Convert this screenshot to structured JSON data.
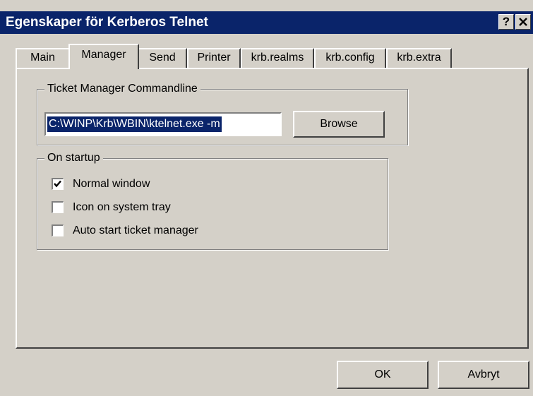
{
  "window": {
    "title": "Egenskaper för Kerberos Telnet",
    "help_label": "?",
    "close_label": "✕"
  },
  "tabs": [
    {
      "label": "Main",
      "active": false
    },
    {
      "label": "Manager",
      "active": true
    },
    {
      "label": "Send",
      "active": false
    },
    {
      "label": "Printer",
      "active": false
    },
    {
      "label": "krb.realms",
      "active": false
    },
    {
      "label": "krb.config",
      "active": false
    },
    {
      "label": "krb.extra",
      "active": false
    }
  ],
  "ticket_manager": {
    "group_label": "Ticket Manager Commandline",
    "command_value": "C:\\WINP\\Krb\\WBIN\\ktelnet.exe -m",
    "browse_label": "Browse"
  },
  "startup": {
    "group_label": "On startup",
    "options": [
      {
        "label": "Normal window",
        "checked": true
      },
      {
        "label": "Icon on system tray",
        "checked": false
      },
      {
        "label": "Auto start ticket manager",
        "checked": false
      }
    ]
  },
  "footer": {
    "ok_label": "OK",
    "cancel_label": "Avbryt"
  },
  "colors": {
    "titlebar": "#0a246a",
    "face": "#d4d0c8",
    "selection": "#0a246a"
  }
}
